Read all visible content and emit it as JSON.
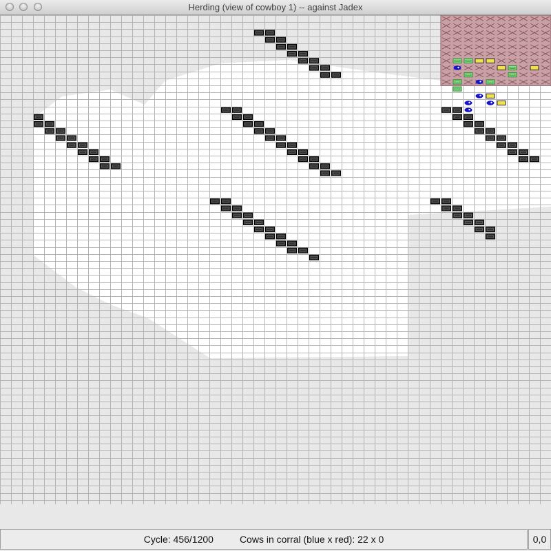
{
  "window": {
    "title": "Herding (view of cowboy 1) -- against Jadex"
  },
  "status": {
    "cycle_label": "Cycle:",
    "cycle_value": "456/1200",
    "cows_label": "Cows in corral (blue x red):",
    "cows_value": "22 x 0",
    "coords": "0,0"
  },
  "map": {
    "corral": {
      "rows": [
        0,
        9
      ],
      "cols": [
        40,
        49
      ]
    },
    "fences": [
      [
        [
          2,
          23
        ],
        [
          2,
          24
        ],
        [
          3,
          24
        ],
        [
          3,
          25
        ],
        [
          4,
          25
        ],
        [
          4,
          26
        ],
        [
          5,
          26
        ],
        [
          5,
          27
        ],
        [
          6,
          27
        ],
        [
          6,
          28
        ],
        [
          7,
          28
        ],
        [
          7,
          29
        ],
        [
          8,
          29
        ],
        [
          8,
          30
        ]
      ],
      [
        [
          13,
          20
        ],
        [
          13,
          21
        ],
        [
          14,
          21
        ],
        [
          14,
          22
        ],
        [
          15,
          22
        ],
        [
          15,
          23
        ],
        [
          16,
          23
        ],
        [
          16,
          24
        ],
        [
          17,
          24
        ],
        [
          17,
          25
        ],
        [
          18,
          25
        ],
        [
          18,
          26
        ],
        [
          19,
          26
        ],
        [
          19,
          27
        ],
        [
          20,
          27
        ],
        [
          20,
          28
        ],
        [
          21,
          28
        ],
        [
          21,
          29
        ],
        [
          22,
          29
        ],
        [
          22,
          30
        ]
      ],
      [
        [
          13,
          40
        ],
        [
          13,
          41
        ],
        [
          14,
          41
        ],
        [
          14,
          42
        ],
        [
          15,
          42
        ],
        [
          15,
          43
        ],
        [
          16,
          43
        ],
        [
          16,
          44
        ],
        [
          17,
          44
        ],
        [
          17,
          45
        ],
        [
          18,
          45
        ],
        [
          18,
          46
        ],
        [
          19,
          46
        ],
        [
          19,
          47
        ],
        [
          20,
          47
        ],
        [
          20,
          48
        ]
      ],
      [
        [
          14,
          3
        ],
        [
          15,
          3
        ],
        [
          15,
          4
        ],
        [
          16,
          4
        ],
        [
          16,
          5
        ],
        [
          17,
          5
        ],
        [
          17,
          6
        ],
        [
          18,
          6
        ],
        [
          18,
          7
        ],
        [
          19,
          7
        ],
        [
          19,
          8
        ],
        [
          20,
          8
        ],
        [
          20,
          9
        ],
        [
          21,
          9
        ],
        [
          21,
          10
        ]
      ],
      [
        [
          26,
          19
        ],
        [
          26,
          20
        ],
        [
          27,
          20
        ],
        [
          27,
          21
        ],
        [
          28,
          21
        ],
        [
          28,
          22
        ],
        [
          29,
          22
        ],
        [
          29,
          23
        ],
        [
          30,
          23
        ],
        [
          30,
          24
        ],
        [
          31,
          24
        ],
        [
          31,
          25
        ],
        [
          32,
          25
        ],
        [
          32,
          26
        ],
        [
          33,
          26
        ],
        [
          33,
          27
        ],
        [
          34,
          28
        ]
      ],
      [
        [
          26,
          39
        ],
        [
          26,
          40
        ],
        [
          27,
          40
        ],
        [
          27,
          41
        ],
        [
          28,
          41
        ],
        [
          28,
          42
        ],
        [
          29,
          42
        ],
        [
          29,
          43
        ],
        [
          30,
          43
        ],
        [
          30,
          44
        ],
        [
          31,
          44
        ]
      ]
    ],
    "switches": [
      [
        6,
        41
      ],
      [
        6,
        42
      ],
      [
        8,
        42
      ],
      [
        9,
        41
      ],
      [
        9,
        44
      ],
      [
        10,
        41
      ],
      [
        7,
        46
      ],
      [
        8,
        46
      ]
    ],
    "targets": [
      [
        6,
        43
      ],
      [
        6,
        44
      ],
      [
        7,
        45
      ],
      [
        7,
        48
      ],
      [
        11,
        44
      ],
      [
        12,
        45
      ]
    ],
    "cows": [
      [
        7,
        41
      ],
      [
        9,
        43
      ],
      [
        11,
        43
      ],
      [
        12,
        42
      ],
      [
        12,
        44
      ],
      [
        13,
        42
      ]
    ],
    "colors": {
      "background": "#e8e8e8",
      "visible": "#ffffff",
      "grid_line": "#b4b4b4",
      "fence": "#333333",
      "corral": "#c9a0a6",
      "switch": "#8ee08e",
      "target": "#f2e14a",
      "cow": "#1414c8"
    }
  }
}
